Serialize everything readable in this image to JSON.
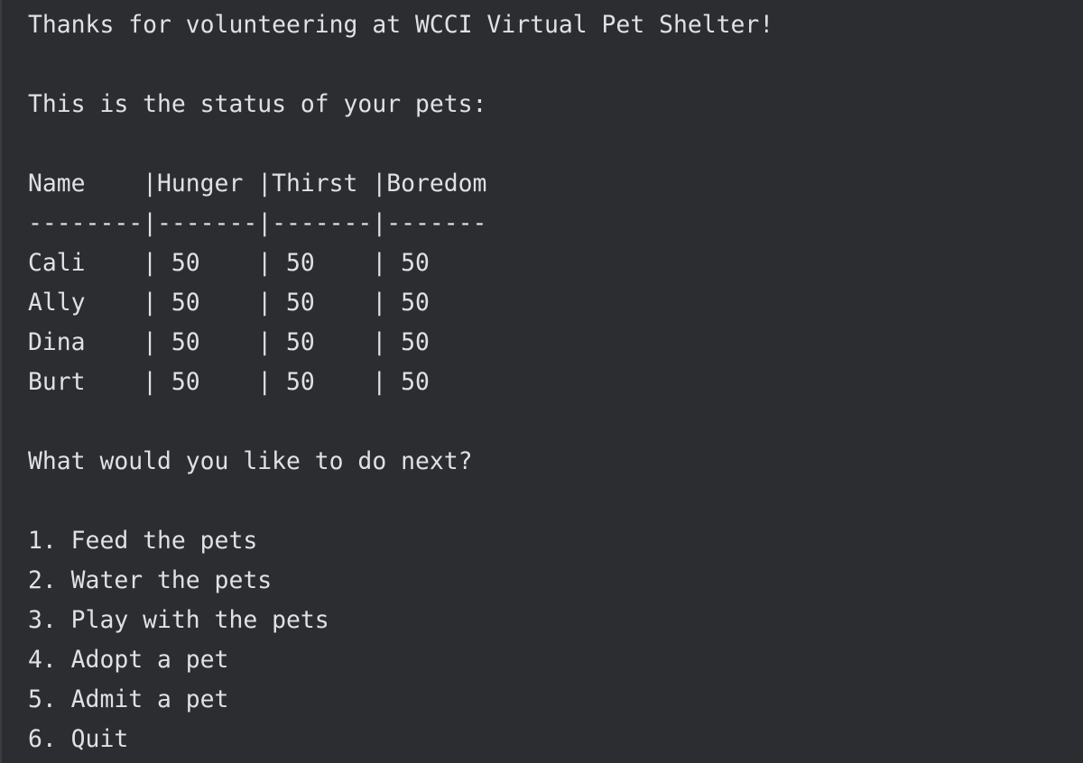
{
  "console": {
    "greeting": "Thanks for volunteering at WCCI Virtual Pet Shelter!",
    "status_intro": "This is the status of your pets:",
    "table_header": "Name    |Hunger |Thirst |Boredom",
    "table_separator": "--------|-------|-------|-------",
    "table_rows": [
      "Cali    | 50    | 50    | 50",
      "Ally    | 50    | 50    | 50",
      "Dina    | 50    | 50    | 50",
      "Burt    | 50    | 50    | 50"
    ],
    "prompt": "What would you like to do next?",
    "menu_options": [
      "1. Feed the pets",
      "2. Water the pets",
      "3. Play with the pets",
      "4. Adopt a pet",
      "5. Admit a pet",
      "6. Quit"
    ]
  },
  "colors": {
    "background": "#2b2d30",
    "text": "#dfe1e5"
  }
}
